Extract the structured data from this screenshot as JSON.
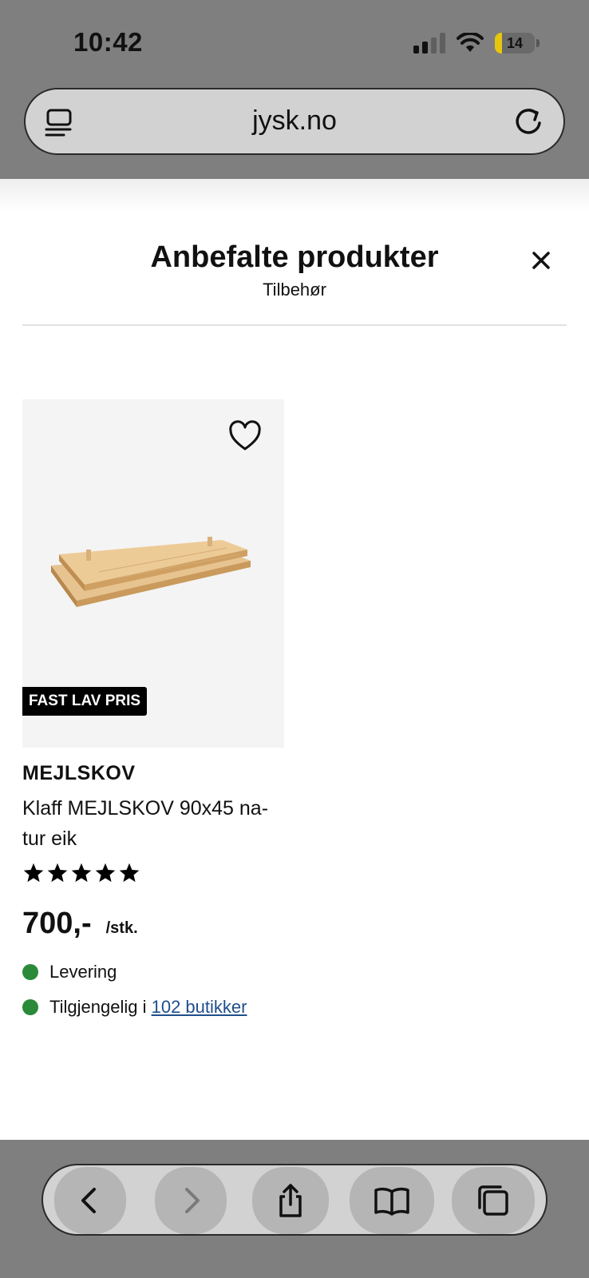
{
  "status_bar": {
    "time": "10:42",
    "battery": "14"
  },
  "browser": {
    "url": "jysk.no"
  },
  "modal": {
    "title": "Anbefalte produkter",
    "subtitle": "Tilbehør"
  },
  "product": {
    "badge": "FAST LAV PRIS",
    "brand": "MEJLSKOV",
    "name": "Klaff MEJLSKOV 90x45 na-tur eik",
    "rating": 5,
    "rating_max": 5,
    "price": "700,-",
    "unit": "/stk.",
    "delivery_label": "Levering",
    "availability_prefix": "Tilgjengelig i ",
    "availability_link": "102 butikker",
    "status_color": "#2a8a3a"
  },
  "toolbar": {
    "icons": [
      "back-icon",
      "forward-icon",
      "share-icon",
      "bookmarks-icon",
      "tabs-icon"
    ]
  }
}
